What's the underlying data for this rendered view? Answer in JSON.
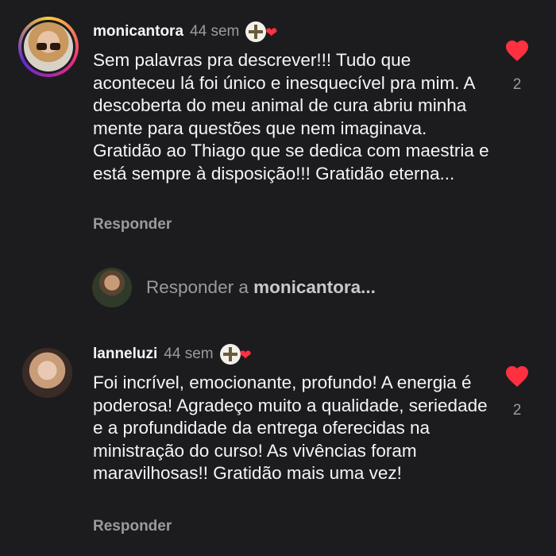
{
  "comments": [
    {
      "username": "monicantora",
      "time": "44 sem",
      "text": "Sem palavras pra descrever!!! Tudo que aconteceu lá foi único e inesquecível pra mim. A descoberta do meu animal de cura abriu minha mente para questões que nem imaginava. Gratidão ao Thiago que se dedica com maestria e está sempre à disposição!!! Gratidão eterna...",
      "reply_label": "Responder",
      "like_count": "2"
    },
    {
      "username": "lanneluzi",
      "time": "44 sem",
      "text": "Foi incrível, emocionante, profundo! A energia é poderosa! Agradeço muito a qualidade, seriedade e a profundidade da entrega oferecidas na ministração do curso! As vivências foram maravilhosas!! Gratidão mais uma vez!",
      "reply_label": "Responder",
      "like_count": "2"
    }
  ],
  "reply_box": {
    "prefix": "Responder a ",
    "target": "monicantora..."
  },
  "colors": {
    "background": "#1c1c1f",
    "text": "#f5f5f5",
    "muted": "#9a9aa0",
    "like": "#ff3040"
  },
  "icons": {
    "like": "heart-icon",
    "badge": "reiki-badge-icon"
  }
}
